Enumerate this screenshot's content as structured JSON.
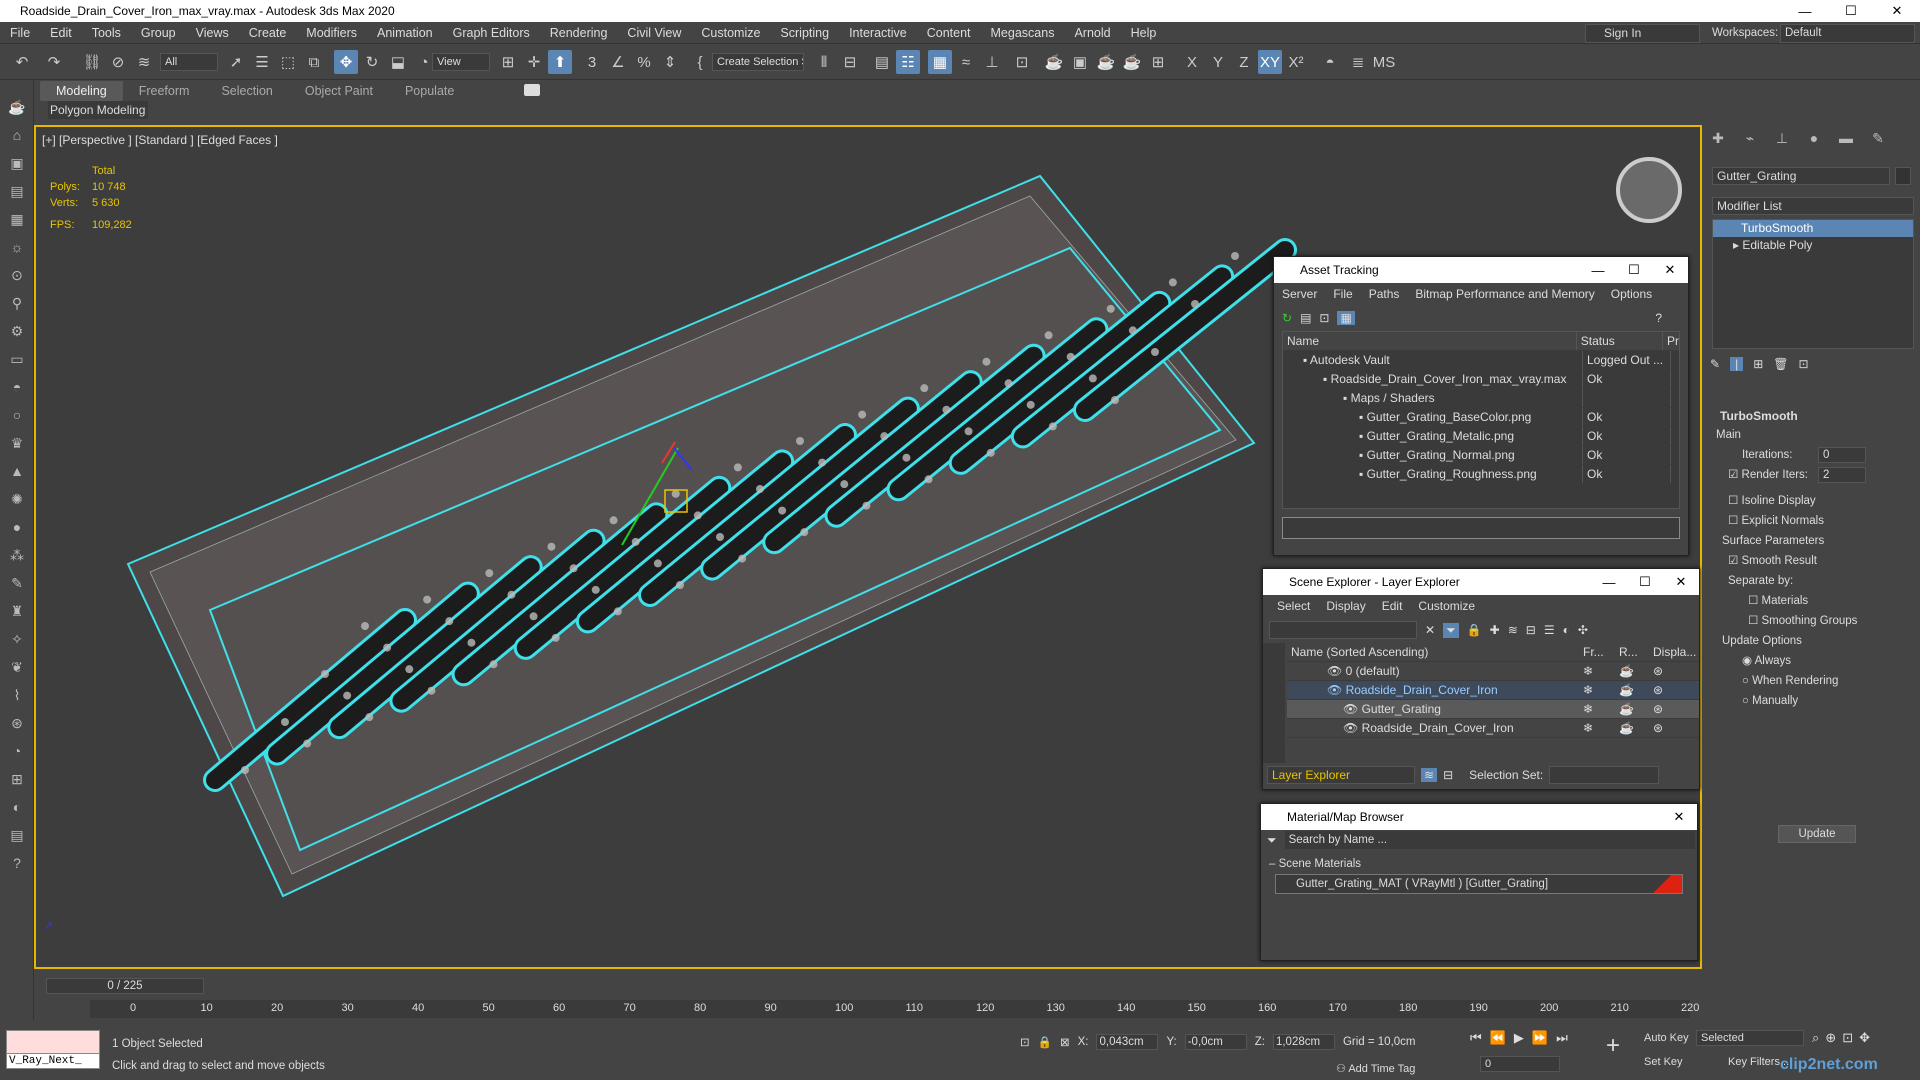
{
  "window": {
    "title": "Roadside_Drain_Cover_Iron_max_vray.max - Autodesk 3ds Max 2020"
  },
  "menu": [
    "File",
    "Edit",
    "Tools",
    "Group",
    "Views",
    "Create",
    "Modifiers",
    "Animation",
    "Graph Editors",
    "Rendering",
    "Civil View",
    "Customize",
    "Scripting",
    "Interactive",
    "Content",
    "Megascans",
    "Arnold",
    "Help"
  ],
  "account": {
    "signin": "Sign In",
    "workspaces_label": "Workspaces:",
    "workspace": "Default"
  },
  "toolbar": {
    "filter": "All",
    "view": "View",
    "selection_set": "Create Selection Se",
    "axes": [
      "X",
      "Y",
      "Z",
      "XY"
    ]
  },
  "ribbon": {
    "tabs": [
      "Modeling",
      "Freeform",
      "Selection",
      "Object Paint",
      "Populate"
    ],
    "sub": "Polygon Modeling"
  },
  "viewport": {
    "label": "[+] [Perspective ] [Standard ] [Edged Faces ]",
    "stats": {
      "total": "Total",
      "polys_label": "Polys:",
      "polys": "10 748",
      "verts_label": "Verts:",
      "verts": "5 630",
      "fps_label": "FPS:",
      "fps": "109,282"
    }
  },
  "asset_tracking": {
    "title": "Asset Tracking",
    "menu": [
      "Server",
      "File",
      "Paths",
      "Bitmap Performance and Memory",
      "Options"
    ],
    "columns": [
      "Name",
      "Status",
      "Pr"
    ],
    "rows": [
      {
        "name": "Autodesk Vault",
        "status": "Logged Out ..."
      },
      {
        "name": "Roadside_Drain_Cover_Iron_max_vray.max",
        "status": "Ok"
      },
      {
        "name": "Maps / Shaders",
        "status": ""
      },
      {
        "name": "Gutter_Grating_BaseColor.png",
        "status": "Ok"
      },
      {
        "name": "Gutter_Grating_Metalic.png",
        "status": "Ok"
      },
      {
        "name": "Gutter_Grating_Normal.png",
        "status": "Ok"
      },
      {
        "name": "Gutter_Grating_Roughness.png",
        "status": "Ok"
      }
    ]
  },
  "scene_explorer": {
    "title": "Scene Explorer - Layer Explorer",
    "menu": [
      "Select",
      "Display",
      "Edit",
      "Customize"
    ],
    "columns": [
      "Name (Sorted Ascending)",
      "Fr...",
      "R...",
      "Displa..."
    ],
    "rows": [
      {
        "name": "0 (default)"
      },
      {
        "name": "Roadside_Drain_Cover_Iron"
      },
      {
        "name": "Gutter_Grating"
      },
      {
        "name": "Roadside_Drain_Cover_Iron"
      }
    ],
    "layer_explorer": "Layer Explorer",
    "selection_set_label": "Selection Set:"
  },
  "material_browser": {
    "title": "Material/Map Browser",
    "search_placeholder": "Search by Name ...",
    "section": "Scene Materials",
    "item": "Gutter_Grating_MAT  ( VRayMtl )  [Gutter_Grating]"
  },
  "command_panel": {
    "object_name": "Gutter_Grating",
    "modifier_list": "Modifier List",
    "stack": [
      "TurboSmooth",
      "Editable Poly"
    ],
    "rollout_title": "TurboSmooth",
    "main": "Main",
    "iterations_label": "Iterations:",
    "iterations": "0",
    "render_iters_label": "Render Iters:",
    "render_iters": "2",
    "isoline": "Isoline Display",
    "explicit": "Explicit Normals",
    "surface_params": "Surface Parameters",
    "smooth_result": "Smooth Result",
    "separate_by": "Separate by:",
    "materials": "Materials",
    "smoothing_groups": "Smoothing Groups",
    "update_options": "Update Options",
    "always": "Always",
    "when_rendering": "When Rendering",
    "manually": "Manually",
    "update": "Update"
  },
  "timeline": {
    "frame": "0 / 225",
    "ticks": [
      "0",
      "10",
      "20",
      "30",
      "40",
      "50",
      "60",
      "70",
      "80",
      "90",
      "100",
      "110",
      "120",
      "130",
      "140",
      "150",
      "160",
      "170",
      "180",
      "190",
      "200",
      "210",
      "220"
    ]
  },
  "status": {
    "script": "V_Ray_Next_",
    "selected": "1 Object Selected",
    "hint": "Click and drag to select and move objects",
    "x_label": "X:",
    "x": "0,043cm",
    "y_label": "Y:",
    "y": "-0,0cm",
    "z_label": "Z:",
    "z": "1,028cm",
    "grid": "Grid = 10,0cm",
    "add_time_tag": "Add Time Tag",
    "auto_key": "Auto Key",
    "set_key": "Set Key",
    "key_mode": "Selected",
    "key_filters": "Key Filters...",
    "frame_field": "0",
    "watermark": "clip2net.com"
  }
}
